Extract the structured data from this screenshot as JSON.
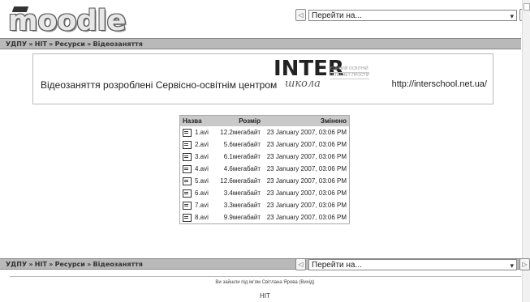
{
  "app": {
    "logo_text": "moodle"
  },
  "jump": {
    "label": "Перейти на...",
    "prev": "◁",
    "next": "▷"
  },
  "breadcrumb": {
    "root": "УДПУ",
    "sep": "»",
    "item1": "НІТ",
    "item2": "Ресурси",
    "current": "Відеозаняття"
  },
  "banner": {
    "text": "Відеозаняття розроблені Сервісно-освітнім центром",
    "logo_main": "INTER",
    "logo_script": "школа",
    "logo_line1": "ЄДИНИЙ ОСВІТНІЙ",
    "logo_line2": "ІНТЕРНЕТ-ПРОСТІР",
    "url": "http://interschool.net.ua/"
  },
  "table": {
    "headers": {
      "name": "Назва",
      "size": "Розмір",
      "modified": "Змінено"
    },
    "rows": [
      {
        "name": "1.avi",
        "size": "12.2мегабайт",
        "modified": "23 January 2007, 03:06 PM"
      },
      {
        "name": "2.avi",
        "size": "5.6мегабайт",
        "modified": "23 January 2007, 03:06 PM"
      },
      {
        "name": "3.avi",
        "size": "6.1мегабайт",
        "modified": "23 January 2007, 03:06 PM"
      },
      {
        "name": "4.avi",
        "size": "4.6мегабайт",
        "modified": "23 January 2007, 03:06 PM"
      },
      {
        "name": "5.avi",
        "size": "12.6мегабайт",
        "modified": "23 January 2007, 03:06 PM"
      },
      {
        "name": "6.avi",
        "size": "3.4мегабайт",
        "modified": "23 January 2007, 03:06 PM"
      },
      {
        "name": "7.avi",
        "size": "3.3мегабайт",
        "modified": "23 January 2007, 03:06 PM"
      },
      {
        "name": "8.avi",
        "size": "9.9мегабайт",
        "modified": "23 January 2007, 03:06 PM"
      }
    ]
  },
  "footer": {
    "login_text": "Ви зайшли під ім'ям Світлана Ярова (Вихід)",
    "course": "НІТ"
  }
}
